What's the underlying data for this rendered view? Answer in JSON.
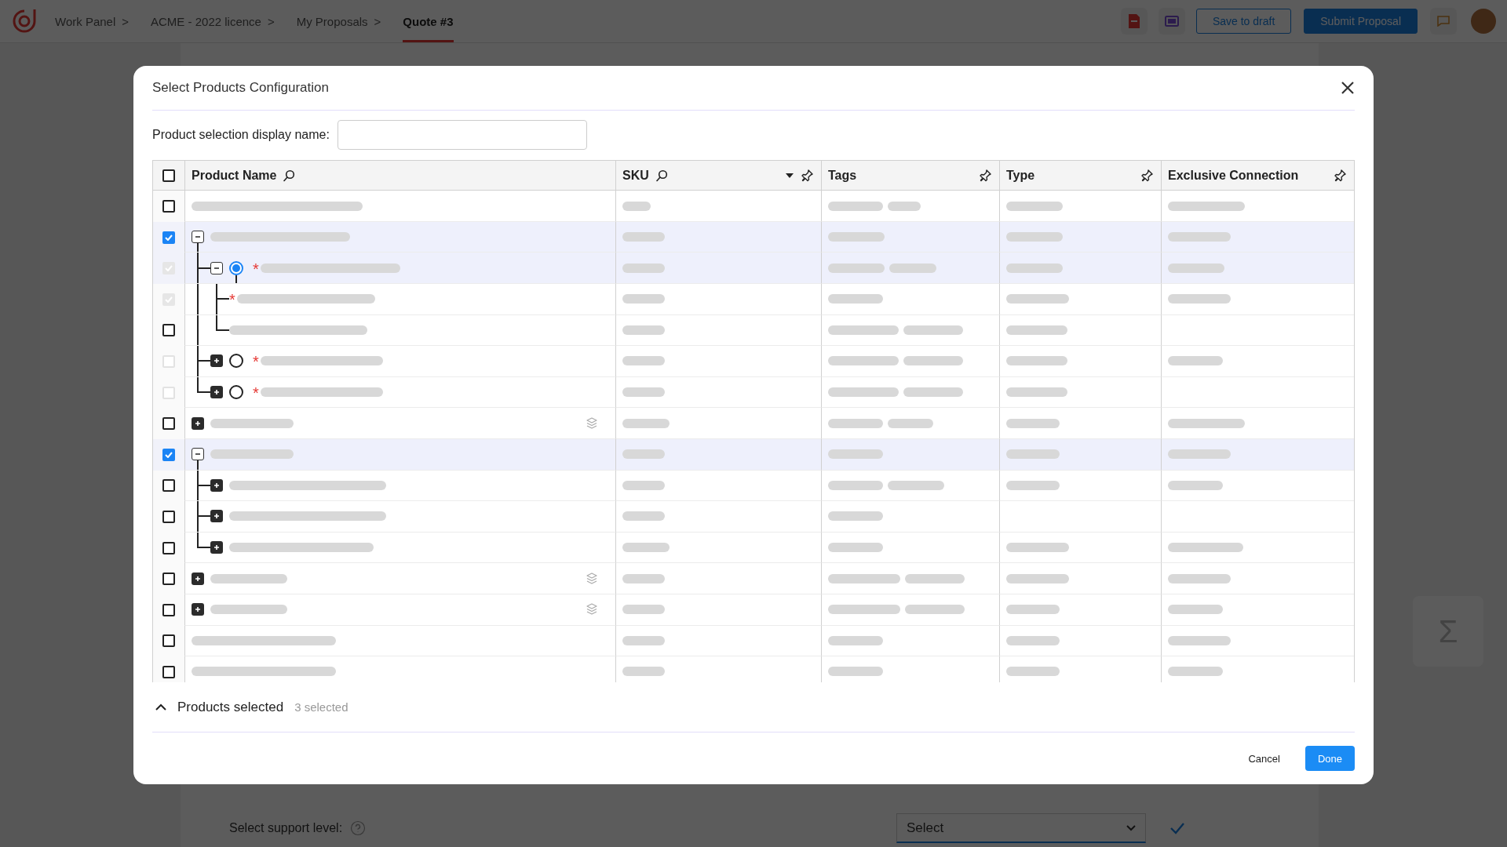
{
  "top_bar": {
    "breadcrumbs": [
      {
        "label": "Work Panel",
        "separator": ">",
        "selected": false
      },
      {
        "label": "ACME - 2022 licence",
        "separator": ">",
        "selected": false
      },
      {
        "label": "My Proposals",
        "separator": ">",
        "selected": false
      },
      {
        "label": "Quote #3",
        "selected": true
      }
    ],
    "buttons": [
      {
        "label": "Save to draft",
        "kind": "outline"
      },
      {
        "label": "Submit Proposal",
        "kind": "primary"
      }
    ]
  },
  "background": {
    "support_label": "Select support level:",
    "select_value": "Select",
    "side_symbol": "Σ"
  },
  "dialog": {
    "title": "Select Products Configuration",
    "display_name_label": "Product selection display name:",
    "columns": [
      {
        "label": "Product Name",
        "searchable": true,
        "pinnable": false
      },
      {
        "label": "SKU",
        "searchable": true,
        "has_menu": true,
        "pinnable": true
      },
      {
        "label": "Tags",
        "searchable": false,
        "pinnable": true
      },
      {
        "label": "Type",
        "searchable": false,
        "pinnable": true
      },
      {
        "label": "Exclusive Connection",
        "searchable": false,
        "pinnable": true
      }
    ],
    "header_checked": false,
    "rows": [
      {
        "checked": false,
        "disabled": false,
        "selected": false
      },
      {
        "checked": true,
        "disabled": false,
        "selected": true,
        "expanded": true,
        "children": [
          {
            "checked": true,
            "disabled": true,
            "selected": true,
            "expanded": true,
            "radio_selected": true,
            "required": "*",
            "children": [
              {
                "checked": true,
                "disabled": true,
                "selected": false,
                "required": "*"
              },
              {
                "checked": false,
                "disabled": false,
                "selected": false
              }
            ]
          },
          {
            "checked": false,
            "disabled": true,
            "selected": false,
            "expanded": false,
            "radio_selected": false,
            "required": "*"
          },
          {
            "checked": false,
            "disabled": true,
            "selected": false,
            "expanded": false,
            "radio_selected": false,
            "required": "*"
          }
        ]
      },
      {
        "checked": false,
        "disabled": false,
        "selected": false,
        "expanded": false,
        "bundle": true
      },
      {
        "checked": true,
        "disabled": false,
        "selected": true,
        "expanded": true,
        "children": [
          {
            "checked": false,
            "disabled": false,
            "selected": false,
            "expanded": false
          },
          {
            "checked": false,
            "disabled": false,
            "selected": false,
            "expanded": false
          },
          {
            "checked": false,
            "disabled": false,
            "selected": false,
            "expanded": false
          }
        ]
      },
      {
        "checked": false,
        "disabled": false,
        "selected": false,
        "expanded": false,
        "bundle": true
      },
      {
        "checked": false,
        "disabled": false,
        "selected": false,
        "expanded": false,
        "bundle": true
      },
      {
        "checked": false,
        "disabled": false,
        "selected": false
      },
      {
        "checked": false,
        "disabled": false,
        "selected": false
      }
    ],
    "footer": {
      "label": "Products selected",
      "count": "3 selected"
    },
    "buttons": [
      {
        "label": "Cancel",
        "kind": "text"
      },
      {
        "label": "Done",
        "kind": "primary"
      }
    ]
  }
}
